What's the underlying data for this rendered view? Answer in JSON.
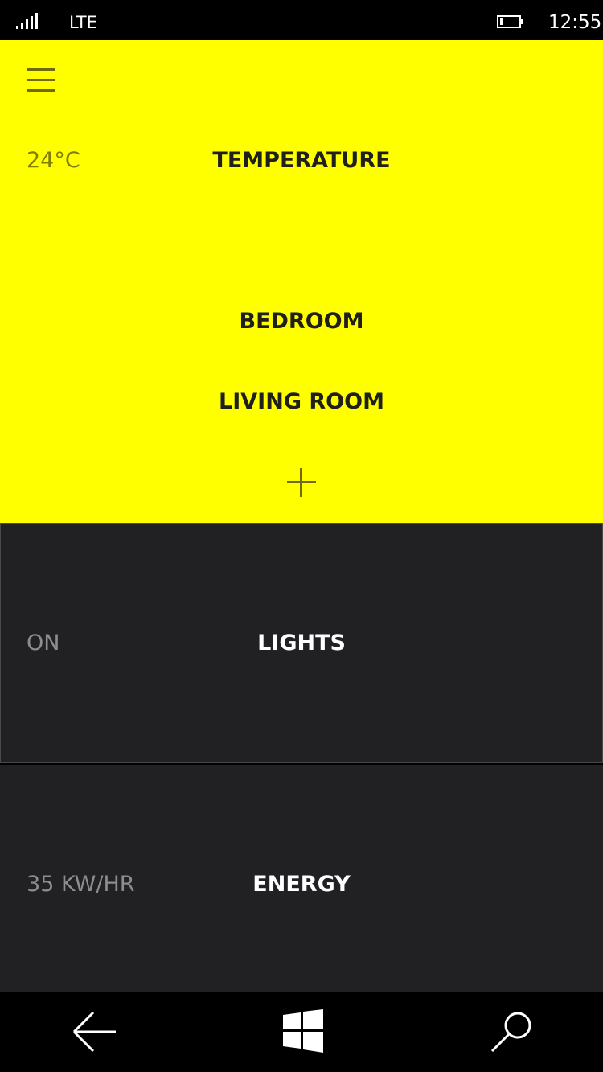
{
  "status_bar": {
    "network": "LTE",
    "time": "12:55",
    "icons": [
      "signal-icon",
      "battery-icon"
    ]
  },
  "temperature_panel": {
    "menu_icon": "hamburger-menu-icon",
    "value": "24°C",
    "title": "TEMPERATURE",
    "rooms": [
      "BEDROOM",
      "LIVING ROOM"
    ],
    "add_icon": "plus-icon",
    "background": "#ffff00"
  },
  "lights_tile": {
    "value": "ON",
    "title": "LIGHTS",
    "background": "#212124"
  },
  "energy_tile": {
    "value": "35 KW/HR",
    "title": "ENERGY",
    "background": "#212124"
  },
  "nav_bar": {
    "icons": [
      "back-arrow-icon",
      "windows-start-icon",
      "search-icon"
    ]
  }
}
